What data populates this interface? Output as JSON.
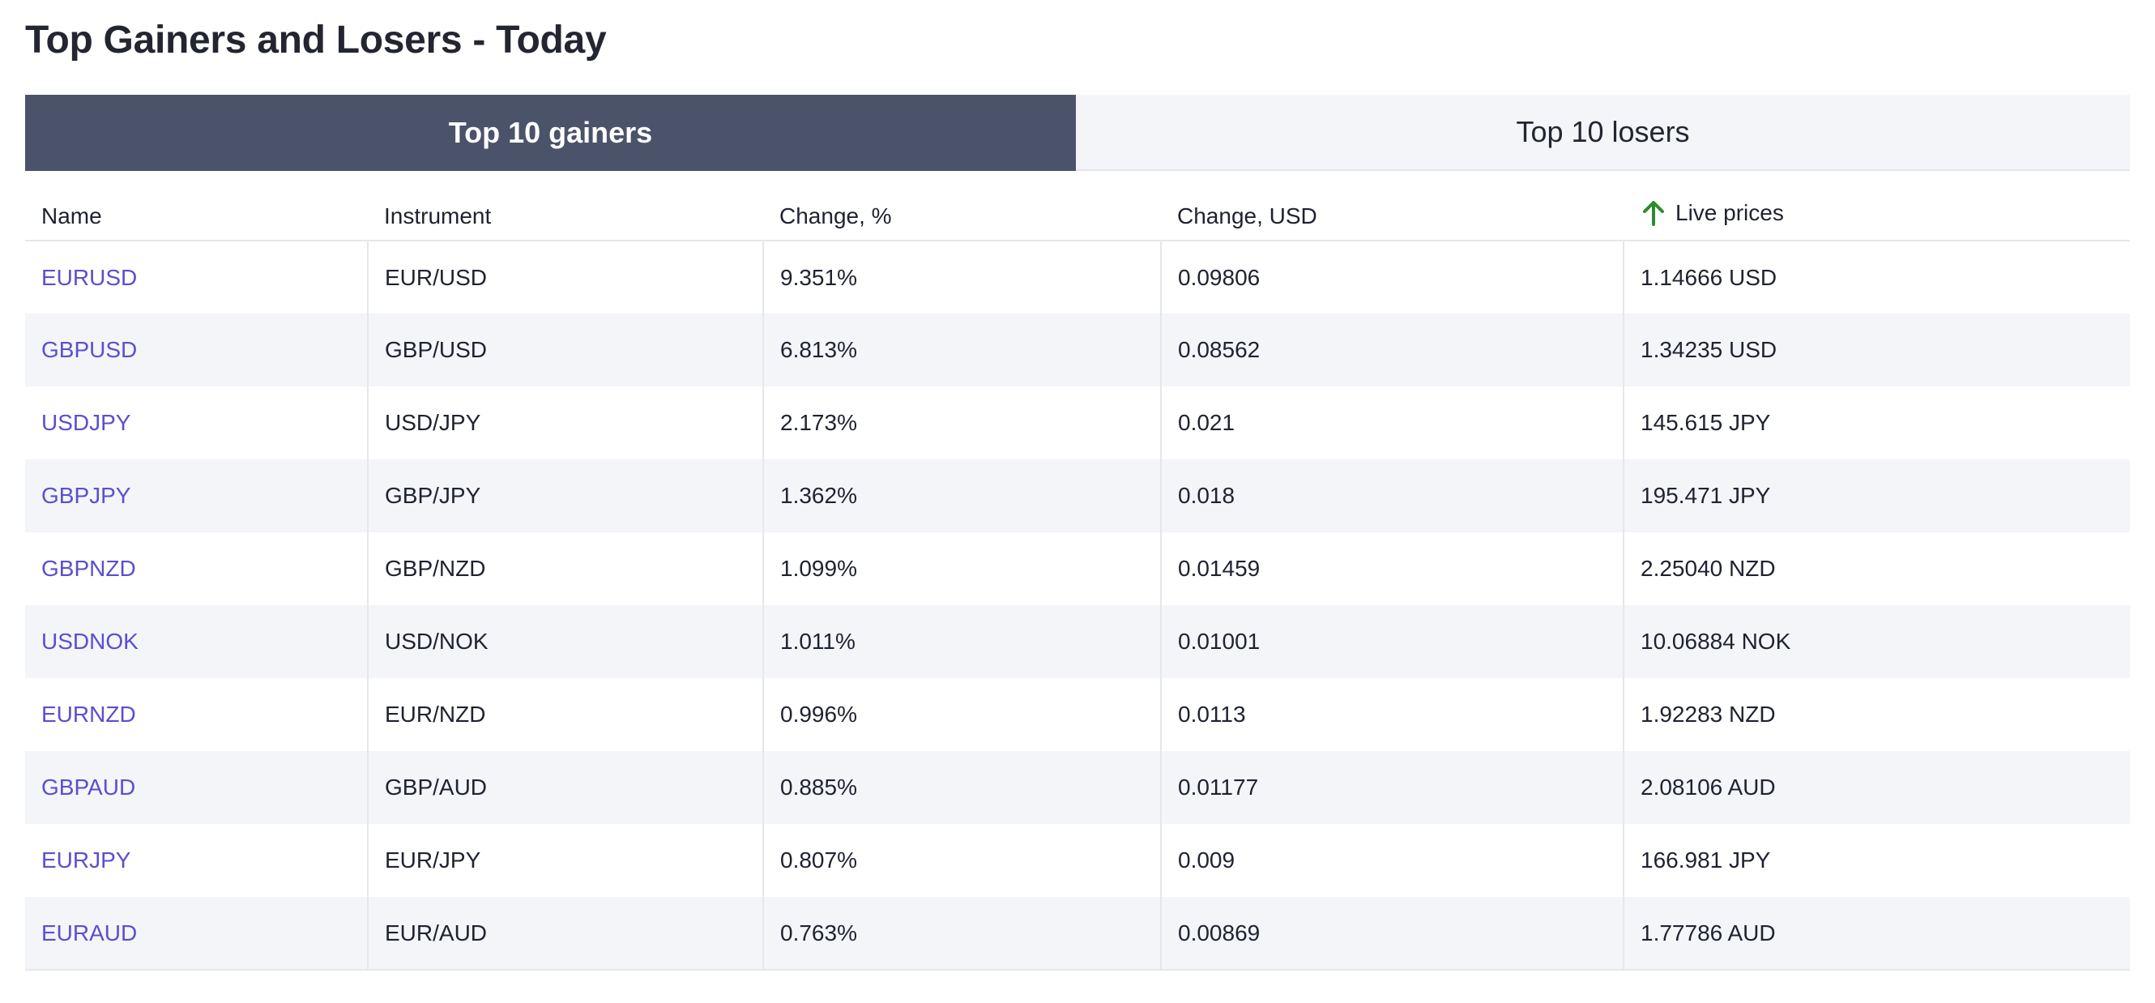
{
  "page": {
    "title": "Top Gainers and Losers - Today"
  },
  "tabs": [
    {
      "label": "Top 10 gainers",
      "active": true
    },
    {
      "label": "Top 10 losers",
      "active": false
    }
  ],
  "table": {
    "columns": [
      "Name",
      "Instrument",
      "Change, %",
      "Change, USD",
      "Live prices"
    ],
    "live_prices_icon": "arrow-up-icon",
    "rows": [
      {
        "name": "EURUSD",
        "instrument": "EUR/USD",
        "change_pct": "9.351%",
        "change_usd": "0.09806",
        "live_price": "1.14666 USD"
      },
      {
        "name": "GBPUSD",
        "instrument": "GBP/USD",
        "change_pct": "6.813%",
        "change_usd": "0.08562",
        "live_price": "1.34235 USD"
      },
      {
        "name": "USDJPY",
        "instrument": "USD/JPY",
        "change_pct": "2.173%",
        "change_usd": "0.021",
        "live_price": "145.615 JPY"
      },
      {
        "name": "GBPJPY",
        "instrument": "GBP/JPY",
        "change_pct": "1.362%",
        "change_usd": "0.018",
        "live_price": "195.471 JPY"
      },
      {
        "name": "GBPNZD",
        "instrument": "GBP/NZD",
        "change_pct": "1.099%",
        "change_usd": "0.01459",
        "live_price": "2.25040 NZD"
      },
      {
        "name": "USDNOK",
        "instrument": "USD/NOK",
        "change_pct": "1.011%",
        "change_usd": "0.01001",
        "live_price": "10.06884 NOK"
      },
      {
        "name": "EURNZD",
        "instrument": "EUR/NZD",
        "change_pct": "0.996%",
        "change_usd": "0.0113",
        "live_price": "1.92283 NZD"
      },
      {
        "name": "GBPAUD",
        "instrument": "GBP/AUD",
        "change_pct": "0.885%",
        "change_usd": "0.01177",
        "live_price": "2.08106 AUD"
      },
      {
        "name": "EURJPY",
        "instrument": "EUR/JPY",
        "change_pct": "0.807%",
        "change_usd": "0.009",
        "live_price": "166.981 JPY"
      },
      {
        "name": "EURAUD",
        "instrument": "EUR/AUD",
        "change_pct": "0.763%",
        "change_usd": "0.00869",
        "live_price": "1.77786 AUD"
      }
    ]
  },
  "colors": {
    "active_tab_bg": "#4b536b",
    "inactive_tab_bg": "#f4f5f9",
    "link": "#5a4fd0",
    "arrow_up": "#2e8b2e",
    "stripe": "#f4f5f9"
  }
}
